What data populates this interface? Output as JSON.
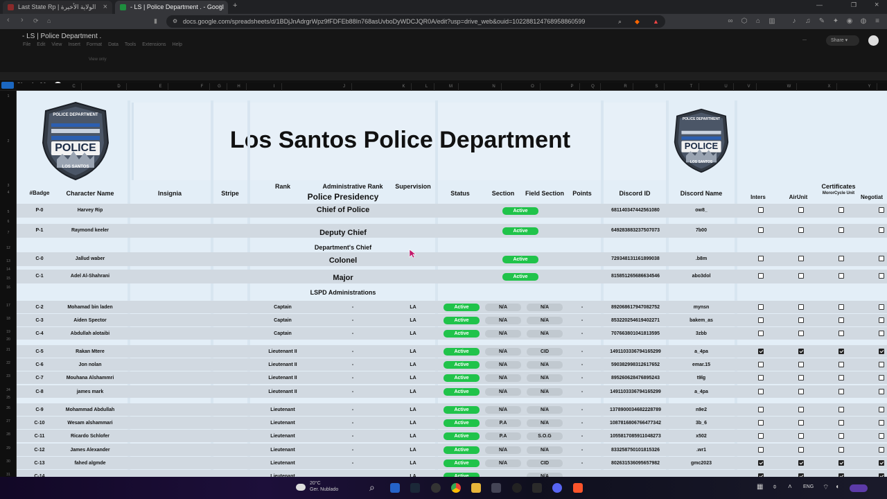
{
  "browser": {
    "tabs": [
      {
        "label": "Last State Rp | الولاية الأخيرة",
        "active": false
      },
      {
        "label": "- LS | Police Department . - Googl",
        "active": true
      }
    ],
    "url": "docs.google.com/spreadsheets/d/1BDjJnAdrgrWpz9fFDFEb88In768asUvboDyWDCJQR0A/edit?usp=drive_web&ouid=102288124768958860599"
  },
  "sheets": {
    "doc_title": "- LS | Police Department .",
    "menu": [
      "File",
      "Edit",
      "View",
      "Insert",
      "Format",
      "Data",
      "Tools",
      "Extensions",
      "Help"
    ],
    "share_label": "Share",
    "view_only": "View only",
    "user_label": "Shushu20 :"
  },
  "columns": [
    "C",
    "D",
    "E",
    "F",
    "G",
    "H",
    "I",
    "J",
    "K",
    "L",
    "M",
    "N",
    "O",
    "P",
    "Q",
    "R",
    "S",
    "T",
    "U",
    "V",
    "W",
    "X",
    "Y"
  ],
  "row_numbers": [
    "1",
    "2",
    "3",
    "4",
    "5",
    "6",
    "7",
    "12",
    "13",
    "14",
    "15",
    "16",
    "17",
    "18",
    "19",
    "20",
    "21",
    "22",
    "23",
    "24",
    "25",
    "26",
    "27",
    "28",
    "29",
    "30",
    "31"
  ],
  "title": "Los Santos Police Department",
  "logo": {
    "top_text": "POLICE DEPARTMENT",
    "main_text": "POLICE",
    "bottom_text": "LOS SANTOS"
  },
  "headers": {
    "badge": "#Badge",
    "name": "Character Name",
    "insignia": "Insignia",
    "stripe": "Stripe",
    "rank": "Rank",
    "admin_rank": "Administrative Rank",
    "supervision": "Supervision",
    "presidency": "Police Presidency",
    "status": "Status",
    "section": "Section",
    "field_section": "Field Section",
    "points": "Points",
    "discord_id": "Discord ID",
    "discord_name": "Discord Name",
    "certificates": "Certificates",
    "cert_cols": [
      "Inters",
      "AirUnit",
      "MororCycle Unit",
      "Negotiat"
    ]
  },
  "groups": {
    "chief_of_police": "Chief of Police",
    "deputy_chief": "Deputy Chief",
    "departments_chief": "Department's Chief",
    "colonel": "Colonel",
    "major": "Major",
    "administrations": "LSPD Administrations"
  },
  "top_rows": [
    {
      "badge": "P-0",
      "name": "Harvey Rip",
      "status": "Active",
      "discord_id": "681140347442561080",
      "discord_name": "ow8_"
    },
    {
      "badge": "P-1",
      "name": "Raymond keeler",
      "status": "Active",
      "discord_id": "649283883237507073",
      "discord_name": "7b00"
    },
    {
      "badge": "C-0",
      "name": "Jallud waber",
      "status": "Active",
      "discord_id": "729348131161899038",
      "discord_name": ".b8m"
    },
    {
      "badge": "C-1",
      "name": "Adel Al-Shahrani",
      "status": "Active",
      "discord_id": "815851265686634546",
      "discord_name": "abo3dol"
    }
  ],
  "rows": [
    {
      "badge": "C-2",
      "name": "Mohamad bin laden",
      "rank": "Captain",
      "admin": "-",
      "sup": "LA",
      "status": "Active",
      "section": "N/A",
      "field": "N/A",
      "points": "-",
      "discord_id": "892068617947082752",
      "discord_name": "mynsn",
      "certs": [
        false,
        false,
        false,
        false
      ]
    },
    {
      "badge": "C-3",
      "name": "Aiden Spector",
      "rank": "Captain",
      "admin": "-",
      "sup": "LA",
      "status": "Active",
      "section": "N/A",
      "field": "N/A",
      "points": "-",
      "discord_id": "853220254619402271",
      "discord_name": "bakem_as",
      "certs": [
        false,
        false,
        false,
        false
      ]
    },
    {
      "badge": "C-4",
      "name": "Abdullah alotaibi",
      "rank": "Captain",
      "admin": "-",
      "sup": "LA",
      "status": "Active",
      "section": "N/A",
      "field": "N/A",
      "points": "-",
      "discord_id": "707663801041813595",
      "discord_name": "3zbb",
      "certs": [
        false,
        false,
        false,
        false
      ]
    },
    {
      "badge": "C-5",
      "name": "Rakan Mtere",
      "rank": "Lieutenant II",
      "admin": "-",
      "sup": "LA",
      "status": "Active",
      "section": "N/A",
      "field": "CID",
      "points": "-",
      "discord_id": "1491103336794165299",
      "discord_name": "a_4pa",
      "certs": [
        true,
        true,
        true,
        true
      ]
    },
    {
      "badge": "C-6",
      "name": "Jon nolan",
      "rank": "Lieutenant II",
      "admin": "-",
      "sup": "LA",
      "status": "Active",
      "section": "N/A",
      "field": "N/A",
      "points": "-",
      "discord_id": "590382998312617652",
      "discord_name": "emar.15",
      "certs": [
        false,
        false,
        false,
        false
      ]
    },
    {
      "badge": "C-7",
      "name": "Mouhana Alshammri",
      "rank": "Lieutenant II",
      "admin": "-",
      "sup": "LA",
      "status": "Active",
      "section": "N/A",
      "field": "N/A",
      "points": "-",
      "discord_id": "895260628476895243",
      "discord_name": "t9lg",
      "certs": [
        false,
        false,
        false,
        false
      ]
    },
    {
      "badge": "C-8",
      "name": "james mark",
      "rank": "Lieutenant II",
      "admin": "-",
      "sup": "LA",
      "status": "Active",
      "section": "N/A",
      "field": "N/A",
      "points": "-",
      "discord_id": "1491103336794165299",
      "discord_name": "a_4pa",
      "certs": [
        false,
        false,
        false,
        false
      ]
    },
    {
      "badge": "C-9",
      "name": "Mohammad Abdullah",
      "rank": "Lieutenant",
      "admin": "-",
      "sup": "LA",
      "status": "Active",
      "section": "N/A",
      "field": "N/A",
      "points": "-",
      "discord_id": "1378900034682228789",
      "discord_name": "n9e2",
      "certs": [
        false,
        false,
        false,
        false
      ]
    },
    {
      "badge": "C-10",
      "name": "Wesam alshammari",
      "rank": "Lieutenant",
      "admin": "-",
      "sup": "LA",
      "status": "Active",
      "section": "P.A",
      "field": "N/A",
      "points": "-",
      "discord_id": "1087816806766477342",
      "discord_name": "3b_6",
      "certs": [
        false,
        false,
        false,
        false
      ]
    },
    {
      "badge": "C-11",
      "name": "Ricardo Schlofer",
      "rank": "Lieutenant",
      "admin": "-",
      "sup": "LA",
      "status": "Active",
      "section": "P.A",
      "field": "S.O.G",
      "points": "-",
      "discord_id": "1055817085911048273",
      "discord_name": "x502",
      "certs": [
        false,
        false,
        false,
        false
      ]
    },
    {
      "badge": "C-12",
      "name": "James Alexander",
      "rank": "Lieutenant",
      "admin": "-",
      "sup": "LA",
      "status": "Active",
      "section": "N/A",
      "field": "N/A",
      "points": "-",
      "discord_id": "833258750101815326",
      "discord_name": ".wr1",
      "certs": [
        false,
        false,
        false,
        false
      ]
    },
    {
      "badge": "C-13",
      "name": "fahed algmde",
      "rank": "Lieutenant",
      "admin": "-",
      "sup": "LA",
      "status": "Active",
      "section": "N/A",
      "field": "CID",
      "points": "-",
      "discord_id": "802631536095657982",
      "discord_name": "gmc2023",
      "certs": [
        true,
        true,
        true,
        true
      ]
    },
    {
      "badge": "C-14",
      "name": "",
      "rank": "Lieutenant",
      "admin": "",
      "sup": "LA",
      "status": "Active",
      "section": "",
      "field": "N/A",
      "points": "",
      "discord_id": "",
      "discord_name": "",
      "certs": [
        true,
        true,
        true,
        true
      ]
    }
  ],
  "taskbar": {
    "temp": "20°C",
    "weather": "Ger. Nublado",
    "lang": "ENG"
  },
  "colors": {
    "active": "#20c34a",
    "sheet_bg": "#e3eef7",
    "row_bar": "#d1d9e1"
  }
}
